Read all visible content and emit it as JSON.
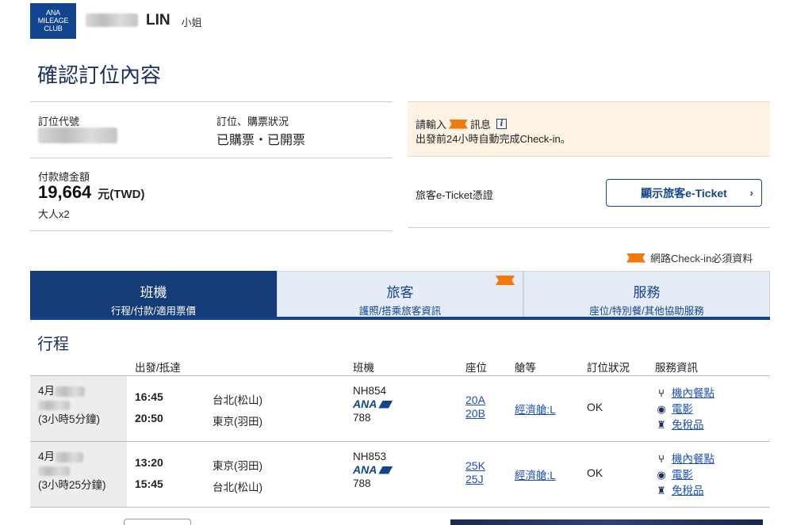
{
  "header": {
    "logo_text": "ANA MILEAGE CLUB",
    "surname": "LIN",
    "honorific": "小姐",
    "brand_color": "#13448f"
  },
  "page_title": "確認訂位內容",
  "booking": {
    "code_label": "訂位代號",
    "status_label": "訂位、購票狀況",
    "status_value": "已購票・已開票",
    "payment_label": "付款總金額",
    "payment_amount": "19,664",
    "payment_currency": "元(TWD)",
    "passengers": "大人x2"
  },
  "notice": {
    "line1_prefix": "請輸入",
    "line1_suffix": "訊息",
    "line2": "出發前24小時自動完成Check-in。",
    "info_icon": "i"
  },
  "eticket": {
    "label": "旅客e-Ticket憑證",
    "button": "顯示旅客e-Ticket",
    "chevron": "›"
  },
  "checkin_note": "網路Check-in必須資料",
  "tabs": [
    {
      "title": "班機",
      "subtitle": "行程/付款/適用票價",
      "active": true
    },
    {
      "title": "旅客",
      "subtitle": "護照/搭乘旅客資訊",
      "active": false
    },
    {
      "title": "服務",
      "subtitle": "座位/特別餐/其他協助服務",
      "active": false
    }
  ],
  "itinerary": {
    "title": "行程",
    "columns": [
      "出發/抵達",
      "班機",
      "座位",
      "艙等",
      "訂位狀況",
      "服務資訊"
    ],
    "flights": [
      {
        "date_prefix": "4月",
        "duration": "(3小時5分鐘)",
        "dep_time": "16:45",
        "dep_city": "台北(松山)",
        "arr_time": "20:50",
        "arr_city": "東京(羽田)",
        "flight_no": "NH854",
        "carrier": "ANA",
        "aircraft": "788",
        "seats": [
          "20A",
          "20B"
        ],
        "cabin": "經濟艙:L",
        "status": "OK",
        "services": [
          "機內餐點",
          "電影",
          "免稅品"
        ]
      },
      {
        "date_prefix": "4月",
        "duration": "(3小時25分鐘)",
        "dep_time": "13:20",
        "dep_city": "東京(羽田)",
        "arr_time": "15:45",
        "arr_city": "台北(松山)",
        "flight_no": "NH853",
        "carrier": "ANA",
        "aircraft": "788",
        "seats": [
          "25K",
          "25J"
        ],
        "cabin": "經濟艙:L",
        "status": "OK",
        "services": [
          "機內餐點",
          "電影",
          "免稅品"
        ]
      }
    ]
  },
  "service_icons": [
    "utensils-icon",
    "film-icon",
    "duty-free-icon"
  ]
}
